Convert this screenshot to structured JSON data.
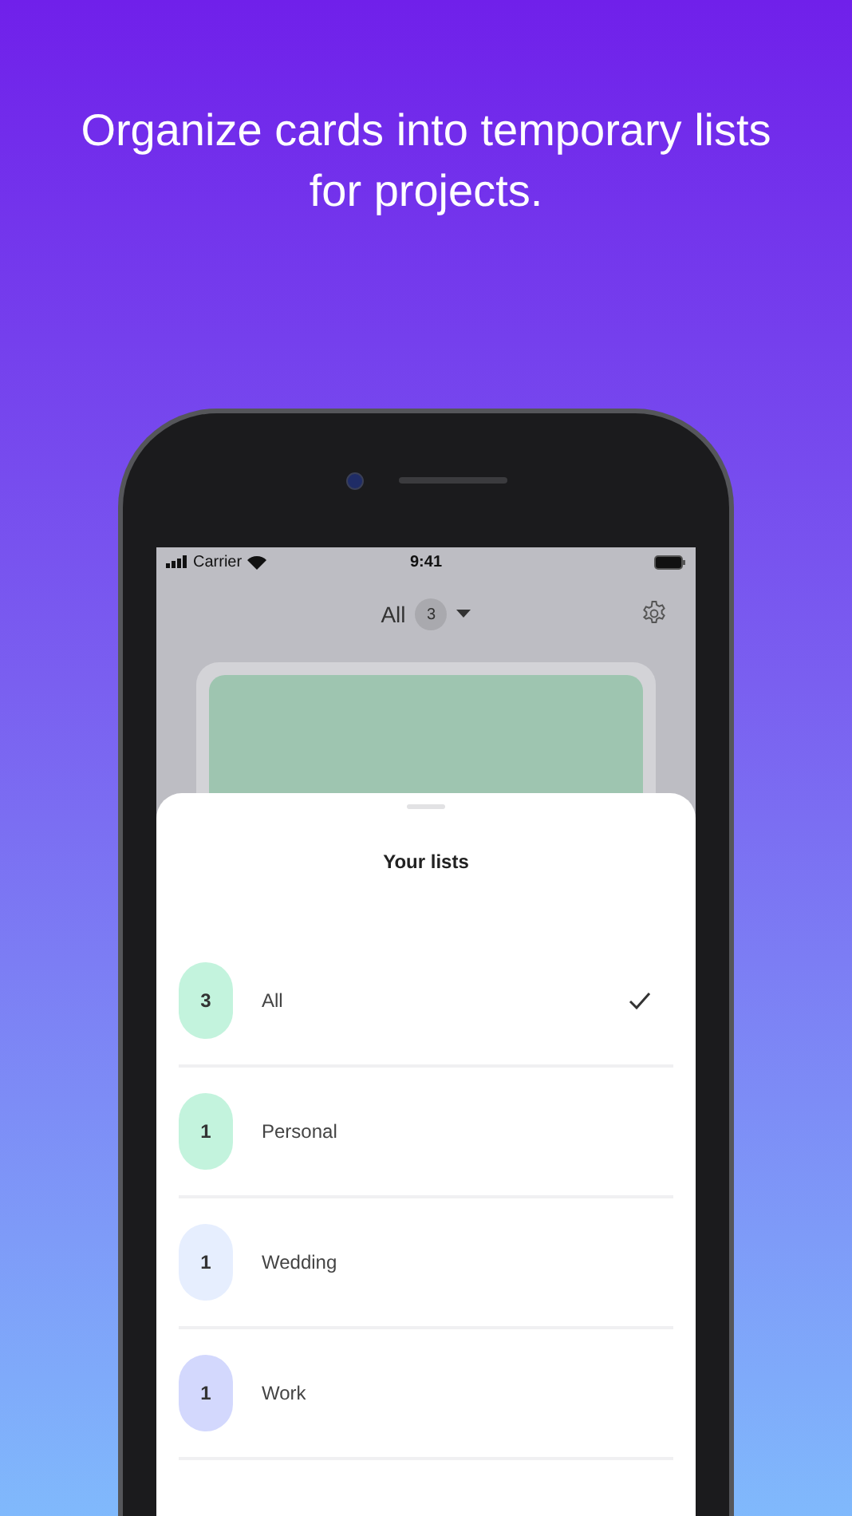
{
  "headline": "Organize cards into temporary lists for projects.",
  "status_bar": {
    "carrier": "Carrier",
    "time": "9:41"
  },
  "header": {
    "title": "All",
    "count": "3"
  },
  "sheet": {
    "title": "Your lists",
    "lists": [
      {
        "count": "3",
        "name": "All",
        "color": "#c3f3dd",
        "selected": true
      },
      {
        "count": "1",
        "name": "Personal",
        "color": "#c3f3dd",
        "selected": false
      },
      {
        "count": "1",
        "name": "Wedding",
        "color": "#e6eefe",
        "selected": false
      },
      {
        "count": "1",
        "name": "Work",
        "color": "#d3d8fd",
        "selected": false
      }
    ]
  }
}
